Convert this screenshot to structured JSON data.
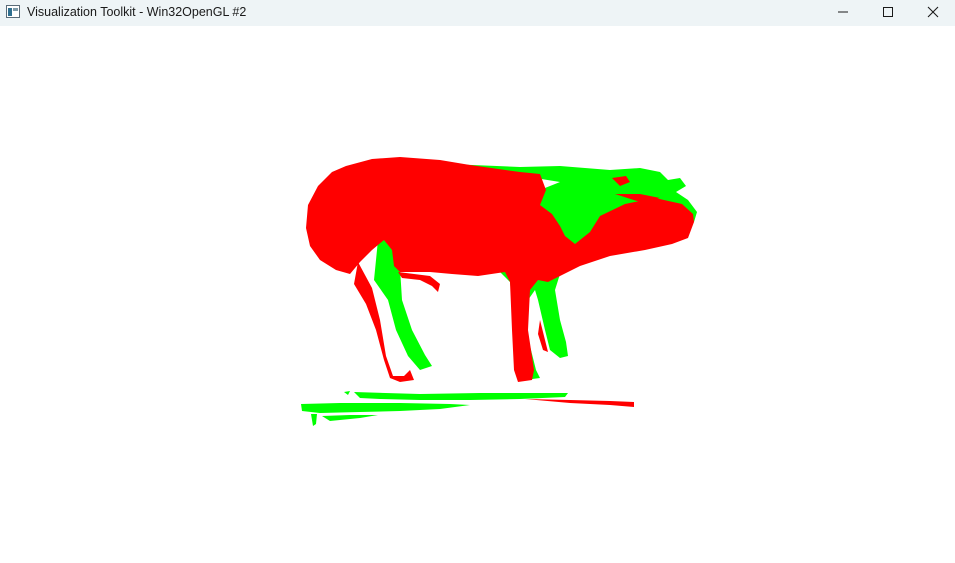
{
  "window": {
    "title": "Visualization Toolkit - Win32OpenGL #2",
    "icon": "vtk-app-icon",
    "controls": {
      "minimize_icon": "minimize-icon",
      "maximize_icon": "maximize-icon",
      "close_icon": "close-icon"
    }
  },
  "viewport": {
    "background": "#ffffff",
    "models": [
      {
        "name": "red-model",
        "color": "#ff0000"
      },
      {
        "name": "green-model",
        "color": "#00ff00"
      }
    ]
  }
}
